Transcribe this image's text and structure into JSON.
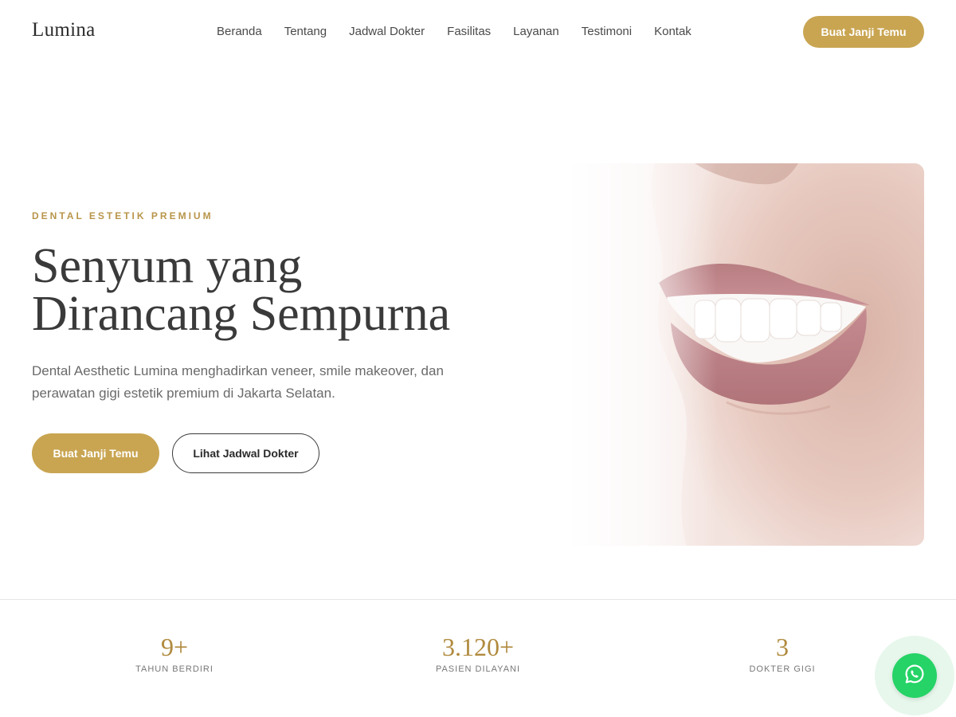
{
  "header": {
    "logo": "Lumina",
    "nav": [
      "Beranda",
      "Tentang",
      "Jadwal Dokter",
      "Fasilitas",
      "Layanan",
      "Testimoni",
      "Kontak"
    ],
    "cta_label": "Buat Janji Temu"
  },
  "hero": {
    "eyebrow": "DENTAL ESTETIK PREMIUM",
    "headline_line1": "Senyum yang",
    "headline_line2": "Dirancang Sempurna",
    "description": "Dental Aesthetic Lumina menghadirkan veneer, smile makeover, dan perawatan gigi estetik premium di Jakarta Selatan.",
    "primary_button": "Buat Janji Temu",
    "secondary_button": "Lihat Jadwal Dokter",
    "image": "smile-portrait-image"
  },
  "stats": [
    {
      "value": "9+",
      "label": "TAHUN BERDIRI"
    },
    {
      "value": "3.120+",
      "label": "PASIEN DILAYANI"
    },
    {
      "value": "3",
      "label": "DOKTER GIGI"
    }
  ],
  "floating": {
    "icon": "whatsapp-icon"
  },
  "colors": {
    "accent": "#c9a552",
    "stat_text": "#b08a3e",
    "whatsapp": "#25d366"
  }
}
